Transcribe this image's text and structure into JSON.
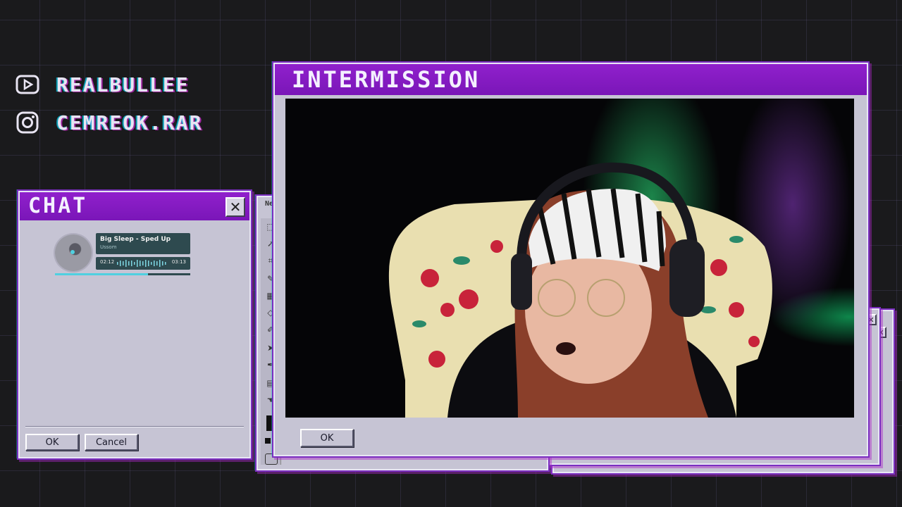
{
  "socials": [
    {
      "icon": "youtube-icon",
      "handle": "REALBULLEE"
    },
    {
      "icon": "instagram-icon",
      "handle": "CEMREOK.RAR"
    }
  ],
  "chat_window": {
    "title": "CHAT",
    "ok_label": "OK",
    "cancel_label": "Cancel",
    "music_player": {
      "track_title": "Big Sleep - Sped Up",
      "artist": "Ussom",
      "elapsed": "02:12",
      "total": "03:13",
      "progress": 0.69
    }
  },
  "paint_window": {
    "title_fragment": "Ne",
    "tool_icons": [
      "select-icon",
      "lasso-icon",
      "crop-icon",
      "pencil-icon",
      "stamp-icon",
      "eraser-icon",
      "brush-icon",
      "pointer-icon",
      "pen-icon",
      "text-icon",
      "hand-icon"
    ]
  },
  "main_window": {
    "title": "INTERMISSION",
    "ok_label": "OK"
  },
  "colors": {
    "titlebar_purple": "#8a1cc4",
    "window_gray": "#c6c4d4",
    "background": "#1a1a1c",
    "player_teal": "#2e4a4f",
    "player_accent": "#4fd0e0"
  }
}
